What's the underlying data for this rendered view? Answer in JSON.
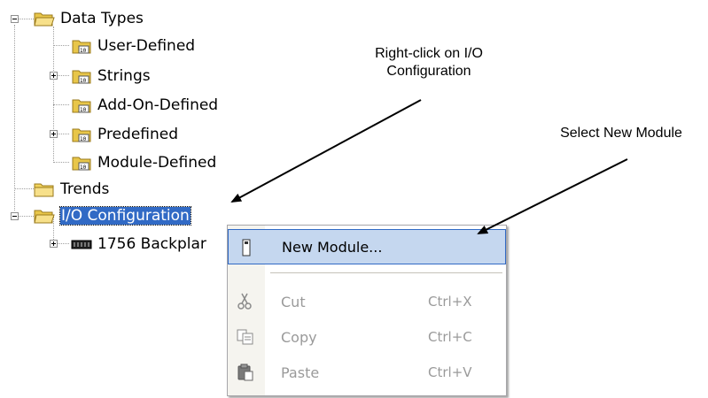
{
  "tree": {
    "items": [
      {
        "label": "Data Types",
        "icon": "folder-open-icon",
        "expander": "minus"
      },
      {
        "label": "User-Defined",
        "icon": "data-folder-icon"
      },
      {
        "label": "Strings",
        "icon": "data-folder-icon",
        "expander": "plus"
      },
      {
        "label": "Add-On-Defined",
        "icon": "data-folder-icon"
      },
      {
        "label": "Predefined",
        "icon": "data-folder-icon",
        "expander": "plus"
      },
      {
        "label": "Module-Defined",
        "icon": "data-folder-icon"
      },
      {
        "label": "Trends",
        "icon": "folder-icon"
      },
      {
        "label": "I/O Configuration",
        "icon": "folder-open-icon",
        "expander": "minus",
        "selected": true
      },
      {
        "label": "1756 Backplar",
        "icon": "backplane-icon",
        "expander": "plus"
      }
    ]
  },
  "context_menu": {
    "items": [
      {
        "label": "New Module...",
        "shortcut": "",
        "icon": "new-module-icon",
        "highlighted": true
      },
      {
        "label": "Cut",
        "shortcut": "Ctrl+X",
        "icon": "scissors-icon",
        "disabled": true
      },
      {
        "label": "Copy",
        "shortcut": "Ctrl+C",
        "icon": "copy-icon",
        "disabled": true
      },
      {
        "label": "Paste",
        "shortcut": "Ctrl+V",
        "icon": "paste-icon",
        "disabled": true
      }
    ]
  },
  "annotations": {
    "right_click": [
      "Right-click on I/O",
      "Configuration"
    ],
    "select_new": "Select New Module"
  },
  "colors": {
    "selection": "#316ac5",
    "menu_highlight": "#c5d7ef",
    "folder": "#f2d45c"
  }
}
